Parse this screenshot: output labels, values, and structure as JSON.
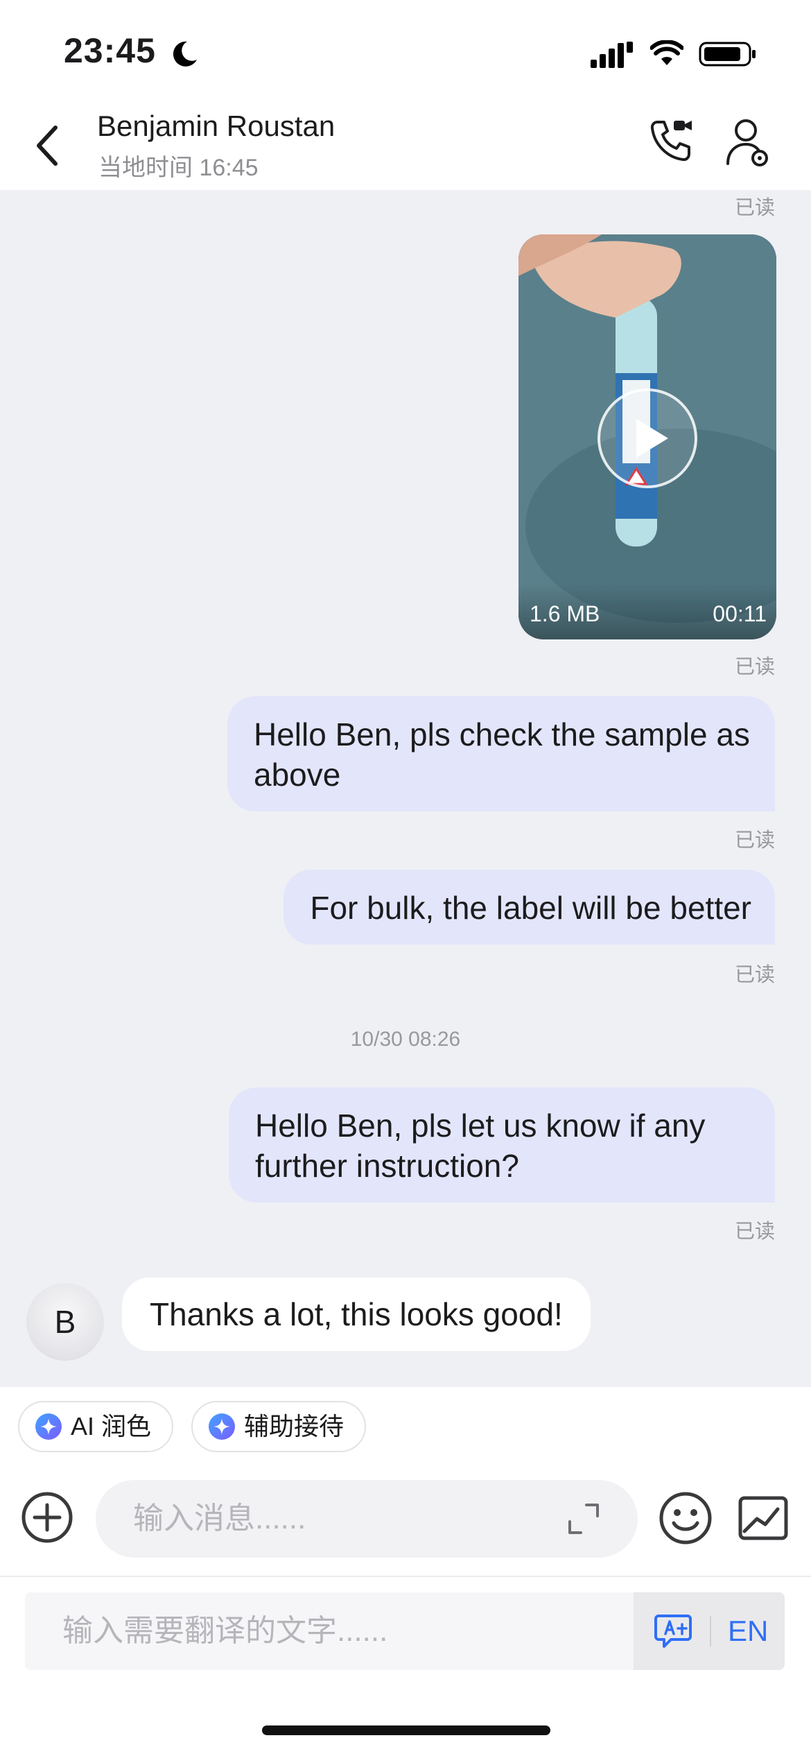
{
  "status_bar": {
    "time": "23:45",
    "icons": [
      "moon-icon",
      "signal-icon",
      "wifi-icon",
      "battery-icon"
    ]
  },
  "header": {
    "contact_name": "Benjamin Roustan",
    "local_time": "当地时间 16:45",
    "icons": [
      "back-icon",
      "video-call-icon",
      "contact-profile-icon"
    ]
  },
  "chat": {
    "read_label": "已读",
    "video_message": {
      "size": "1.6 MB",
      "duration": "00:11"
    },
    "messages_before_time": [
      "Hello Ben, pls check the sample as above",
      "For bulk, the label will be better"
    ],
    "timestamp": "10/30 08:26",
    "messages_after_time": [
      "Hello Ben, pls let us know if any further instruction?"
    ],
    "incoming": {
      "avatar_initial": "B",
      "text": "Thanks a lot, this looks good!"
    }
  },
  "quick_actions": [
    {
      "label": "AI 润色",
      "icon": "sparkle-icon"
    },
    {
      "label": "辅助接待",
      "icon": "sparkle-icon"
    }
  ],
  "composer": {
    "placeholder": "输入消息......",
    "icons": [
      "add-icon",
      "expand-icon",
      "emoji-icon",
      "image-icon"
    ]
  },
  "translate": {
    "placeholder": "输入需要翻译的文字......",
    "language": "EN",
    "icon": "translate-icon"
  },
  "colors": {
    "chat_background": "#eff0f4",
    "outgoing_bubble": "#e3e5fb",
    "accent_blue": "#2f6ff5"
  }
}
